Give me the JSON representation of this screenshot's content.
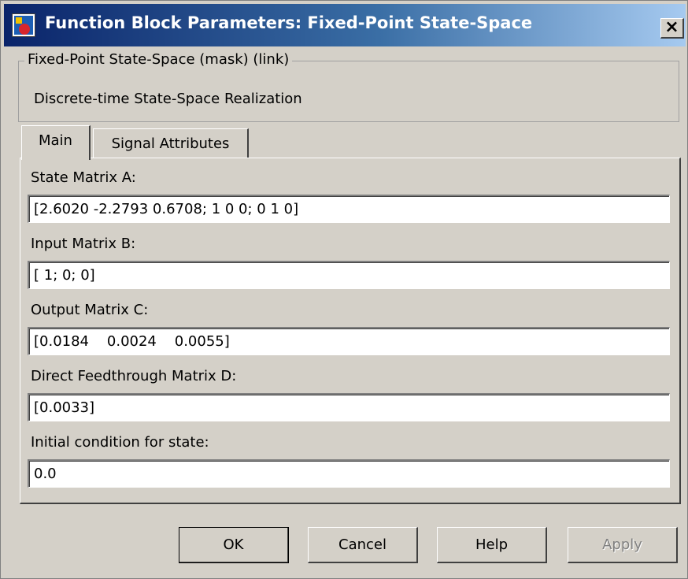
{
  "window": {
    "title": "Function Block Parameters: Fixed-Point State-Space",
    "close_label": "×"
  },
  "group": {
    "legend": "Fixed-Point State-Space (mask) (link)",
    "description": "Discrete-time State-Space Realization"
  },
  "tabs": [
    {
      "label": "Main",
      "selected": true
    },
    {
      "label": "Signal Attributes",
      "selected": false
    }
  ],
  "fields": [
    {
      "label": "State Matrix A:",
      "value": "[2.6020 -2.2793 0.6708; 1 0 0; 0 1 0]"
    },
    {
      "label": "Input Matrix B:",
      "value": "[ 1; 0; 0]"
    },
    {
      "label": "Output Matrix C:",
      "value": "[0.0184    0.0024    0.0055]"
    },
    {
      "label": "Direct Feedthrough Matrix D:",
      "value": "[0.0033]"
    },
    {
      "label": "Initial condition for state:",
      "value": "0.0"
    }
  ],
  "buttons": {
    "ok": "OK",
    "cancel": "Cancel",
    "help": "Help",
    "apply": "Apply",
    "apply_enabled": false
  },
  "colors": {
    "titlebar_start": "#0a246a",
    "titlebar_end": "#a6caf0",
    "dialog_bg": "#d4d0c8"
  },
  "icons": {
    "app": "simulink-block-icon",
    "close": "close-icon"
  }
}
